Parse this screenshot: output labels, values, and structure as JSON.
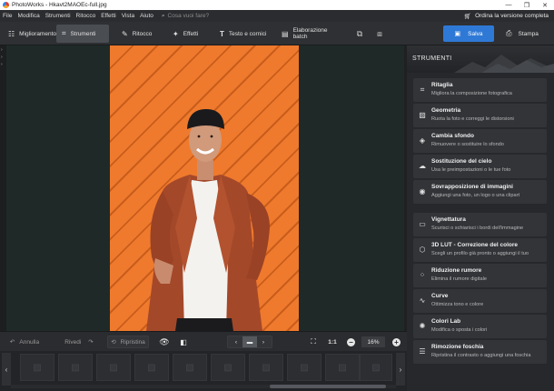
{
  "window": {
    "title": "PhotoWorks - Hkavt2MAOEc-full.jpg",
    "min": "—",
    "max": "❐",
    "close": "✕"
  },
  "menu": {
    "items": [
      "File",
      "Modifica",
      "Strumenti",
      "Ritocco",
      "Effetti",
      "Vista",
      "Aiuto"
    ],
    "search_placeholder": "Cosa vuoi fare?",
    "order_label": "Ordina la versione completa"
  },
  "toolbar": {
    "tabs": [
      {
        "label": "Miglioramento",
        "icon": "sliders-icon"
      },
      {
        "label": "Strumenti",
        "icon": "crop-icon"
      },
      {
        "label": "Ritocco",
        "icon": "brush-icon"
      },
      {
        "label": "Effetti",
        "icon": "magic-icon"
      },
      {
        "label": "Testo e cornici",
        "icon": "text-icon"
      },
      {
        "label": "Elaborazione batch",
        "icon": "batch-icon"
      }
    ],
    "active_tab": "Strumenti",
    "save_label": "Salva",
    "print_label": "Stampa"
  },
  "panel": {
    "header": "STRUMENTI",
    "tools": [
      {
        "title": "Ritaglia",
        "desc": "Migliora la composizione fotografica",
        "icon": "crop-icon"
      },
      {
        "title": "Geometria",
        "desc": "Ruota la foto e correggi le distorsioni",
        "icon": "image-icon"
      },
      {
        "title": "Cambia sfondo",
        "desc": "Rimuovere o sostituire lo sfondo",
        "icon": "fill-icon"
      },
      {
        "title": "Sostituzione del cielo",
        "desc": "Usa le preimpostazioni o le tue foto",
        "icon": "cloud-icon"
      },
      {
        "title": "Sovrapposizione di immagini",
        "desc": "Aggiungi una foto, un logo o una clipart",
        "icon": "overlay-icon"
      },
      {
        "title": "Vignettatura",
        "desc": "Scurisci o schiarisci i bordi dell'immagine",
        "icon": "vignette-icon"
      },
      {
        "title": "3D LUT - Correzione del colore",
        "desc": "Scegli un profilo già pronto o aggiungi il tuo",
        "icon": "cube-icon"
      },
      {
        "title": "Riduzione rumore",
        "desc": "Elimina il rumore digitale",
        "icon": "noise-icon"
      },
      {
        "title": "Curve",
        "desc": "Ottimizza tono e colore",
        "icon": "curve-icon"
      },
      {
        "title": "Colori Lab",
        "desc": "Modifica o sposta i colori",
        "icon": "aperture-icon"
      },
      {
        "title": "Rimozione foschia",
        "desc": "Ripristina il contrasto o aggiungi una foschia",
        "icon": "haze-icon"
      }
    ]
  },
  "bottom": {
    "undo_label": "Annulla",
    "redo_label": "Rivedi",
    "reset_label": "Ripristina",
    "ratio_label": "1:1",
    "zoom_value": "16%",
    "zoom_out": "−",
    "zoom_in": "+"
  },
  "colors": {
    "accent": "#2f79d6",
    "photo_bg": "#ef7a2d",
    "panel_bg": "#27282b"
  }
}
